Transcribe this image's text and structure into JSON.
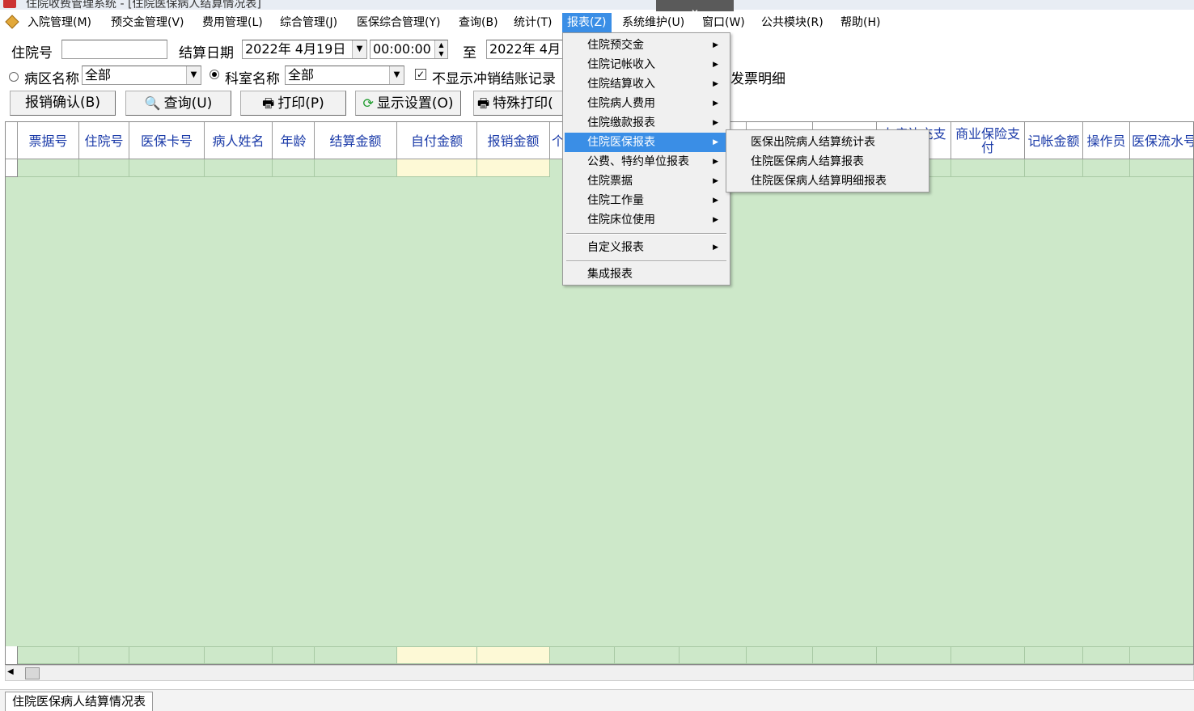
{
  "window": {
    "title": "住院收费管理系统 - [住院医保病人结算情况表]"
  },
  "menubar": [
    {
      "label": "入院管理(M)"
    },
    {
      "label": "预交金管理(V)"
    },
    {
      "label": "费用管理(L)"
    },
    {
      "label": "综合管理(J)"
    },
    {
      "label": "医保综合管理(Y)"
    },
    {
      "label": "查询(B)"
    },
    {
      "label": "统计(T)"
    },
    {
      "label": "报表(Z)"
    },
    {
      "label": "系统维护(U)"
    },
    {
      "label": "窗口(W)"
    },
    {
      "label": "公共模块(R)"
    },
    {
      "label": "帮助(H)"
    }
  ],
  "filters": {
    "admission_no_label": "住院号",
    "admission_no_value": "",
    "settle_date_label": "结算日期",
    "date_from": "2022年 4月19日",
    "time_from": "00:00:00",
    "to_label": "至",
    "date_to": "2022年 4月",
    "ward_label": "病区名称",
    "ward_value": "全部",
    "dept_label": "科室名称",
    "dept_value": "全部",
    "hide_reversed_label": "不显示冲销结账记录",
    "invoice_detail_fragment": "发票明细"
  },
  "buttons": {
    "confirm": "报销确认(B)",
    "query": "查询(U)",
    "print": "打印(P)",
    "display": "显示设置(O)",
    "special_print": "特殊打印("
  },
  "table": {
    "headers": [
      "票据号",
      "住院号",
      "医保卡号",
      "病人姓名",
      "年龄",
      "结算金额",
      "自付金额",
      "报销金额",
      "个",
      "",
      "",
      "",
      "",
      "大病补充支付",
      "商业保险支付",
      "记帐金额",
      "操作员",
      "医保流水号"
    ],
    "visible_headers": {
      "h0": "票据号",
      "h1": "住院号",
      "h2": "医保卡号",
      "h3": "病人姓名",
      "h4": "年龄",
      "h5": "结算金额",
      "h6": "自付金额",
      "h7": "报销金额",
      "h8": "个",
      "h13": "大病补充支",
      "h14": "商业保险支付",
      "h15": "记帐金额",
      "h16": "操作员",
      "h17": "医保流水号"
    }
  },
  "dropdown": {
    "items": [
      {
        "label": "住院预交金"
      },
      {
        "label": "住院记帐收入"
      },
      {
        "label": "住院结算收入"
      },
      {
        "label": "住院病人费用"
      },
      {
        "label": "住院缴款报表"
      },
      {
        "label": "住院医保报表"
      },
      {
        "label": "公费、特约单位报表"
      },
      {
        "label": "住院票据"
      },
      {
        "label": "住院工作量"
      },
      {
        "label": "住院床位使用"
      },
      {
        "label": "自定义报表"
      },
      {
        "label": "集成报表"
      }
    ],
    "submenu": [
      {
        "label": "医保出院病人结算统计表"
      },
      {
        "label": "住院医保病人结算报表"
      },
      {
        "label": "住院医保病人结算明细报表"
      }
    ]
  },
  "statusbar": {
    "tab": "住院医保病人结算情况表"
  },
  "colors": {
    "menu_highlight": "#3a8ee6",
    "grid_bg": "#cde8c9",
    "header_text": "#1a3aa8"
  }
}
